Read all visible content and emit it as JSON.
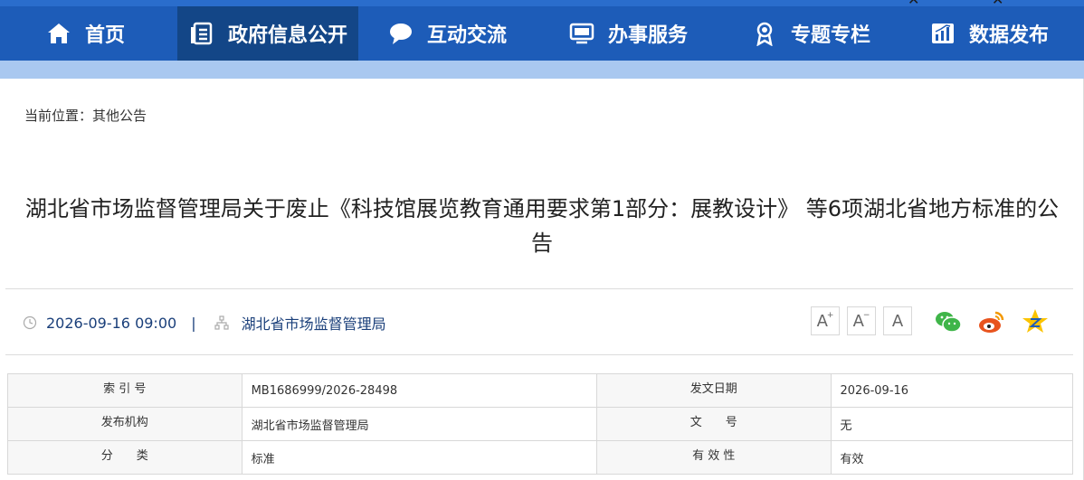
{
  "nav": {
    "items": [
      {
        "label": "首页",
        "icon": "home-icon"
      },
      {
        "label": "政府信息公开",
        "icon": "document-list-icon"
      },
      {
        "label": "互动交流",
        "icon": "chat-bubble-icon"
      },
      {
        "label": "办事服务",
        "icon": "monitor-icon"
      },
      {
        "label": "专题专栏",
        "icon": "award-icon"
      },
      {
        "label": "数据发布",
        "icon": "bar-chart-icon"
      }
    ],
    "active_index": 1,
    "colors": {
      "bar": "#1d5cb8",
      "active": "#134687",
      "band": "#a9c8f0"
    }
  },
  "breadcrumb": "当前位置：其他公告",
  "title": "湖北省市场监督管理局关于废止《科技馆展览教育通用要求第1部分：展教设计》 等6项湖北省地方标准的公告",
  "meta": {
    "datetime": "2026-09-16 09:00",
    "separator": "|",
    "publisher": "湖北省市场监督管理局"
  },
  "font_controls": [
    "A",
    "A",
    "A"
  ],
  "share": [
    "wechat-icon",
    "weibo-icon",
    "qzone-icon"
  ],
  "info_table": {
    "rows": [
      {
        "label1": "索 引 号",
        "value1": "MB1686999/2026-28498",
        "label2": "发文日期",
        "value2": "2026-09-16"
      },
      {
        "label1": "发布机构",
        "value1": "湖北省市场监督管理局",
        "label2": "文　　号",
        "value2": "无"
      },
      {
        "label1": "分　　类",
        "value1": "标准",
        "label2": "有 效 性",
        "value2": "有效"
      }
    ]
  }
}
